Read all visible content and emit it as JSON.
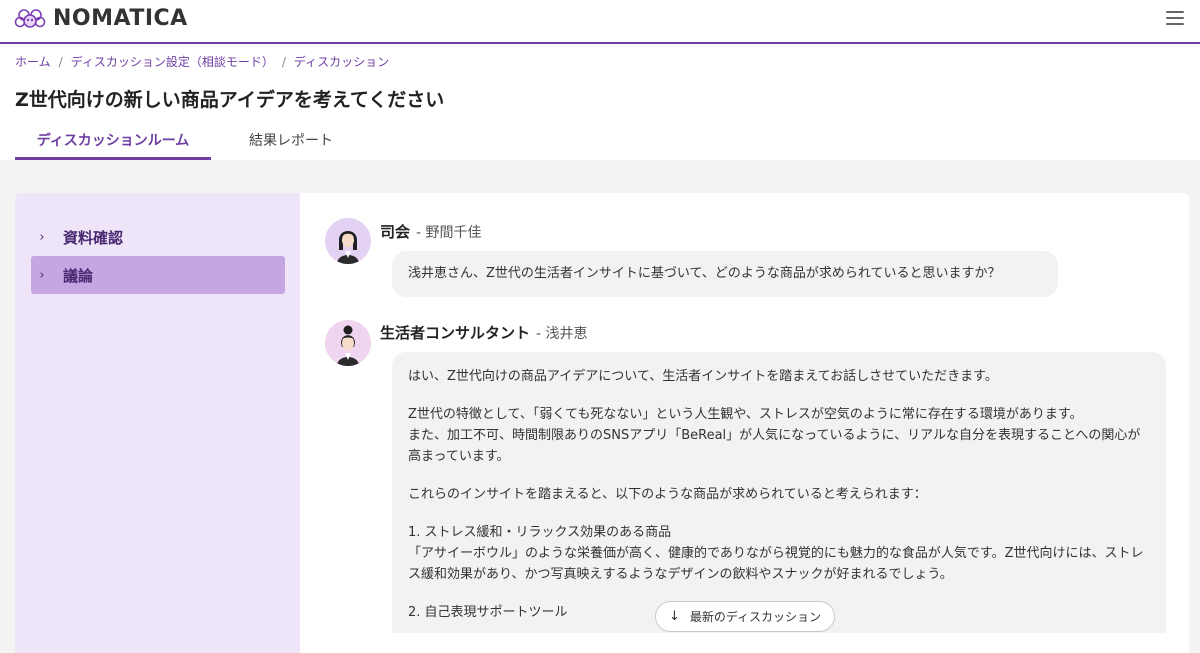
{
  "header": {
    "logo_text": "NOMATICA",
    "menu_icon": "hamburger-menu-icon"
  },
  "breadcrumb": [
    {
      "label": "ホーム"
    },
    {
      "label": "ディスカッション設定（相談モード）"
    },
    {
      "label": "ディスカッション"
    }
  ],
  "page_title": "Z世代向けの新しい商品アイデアを考えてください",
  "tabs": [
    {
      "label": "ディスカッションルーム",
      "active": true
    },
    {
      "label": "結果レポート",
      "active": false
    }
  ],
  "sidebar": {
    "items": [
      {
        "label": "資料確認",
        "active": false
      },
      {
        "label": "議論",
        "active": true
      }
    ]
  },
  "messages": [
    {
      "role": "司会",
      "name": "- 野間千佳",
      "paragraphs": [
        "浅井恵さん、Z世代の生活者インサイトに基づいて、どのような商品が求められていると思いますか？"
      ]
    },
    {
      "role": "生活者コンサルタント",
      "name": "- 浅井恵",
      "paragraphs": [
        "はい、Z世代向けの商品アイデアについて、生活者インサイトを踏まえてお話しさせていただきます。",
        "Z世代の特徴として、「弱くても死なない」という人生観や、ストレスが空気のように常に存在する環境があります。\nまた、加工不可、時間制限ありのSNSアプリ「BeReal」が人気になっているように、リアルな自分を表現することへの関心が高まっています。",
        "これらのインサイトを踏まえると、以下のような商品が求められていると考えられます：",
        "1. ストレス緩和・リラックス効果のある商品\n「アサイーボウル」のような栄養価が高く、健康的でありながら視覚的にも魅力的な食品が人気です。Z世代向けには、ストレス緩和効果があり、かつ写真映えするようなデザインの飲料やスナックが好まれるでしょう。",
        "2. 自己表現サポートツール"
      ]
    }
  ],
  "latest_button": {
    "label": "最新のディスカッション",
    "icon": "arrow-down-icon"
  },
  "colors": {
    "accent": "#6e3ea3",
    "sidebar_bg": "#efe5f8",
    "sidebar_active": "#c6a5e3",
    "bubble_bg": "#f2f2f2"
  }
}
